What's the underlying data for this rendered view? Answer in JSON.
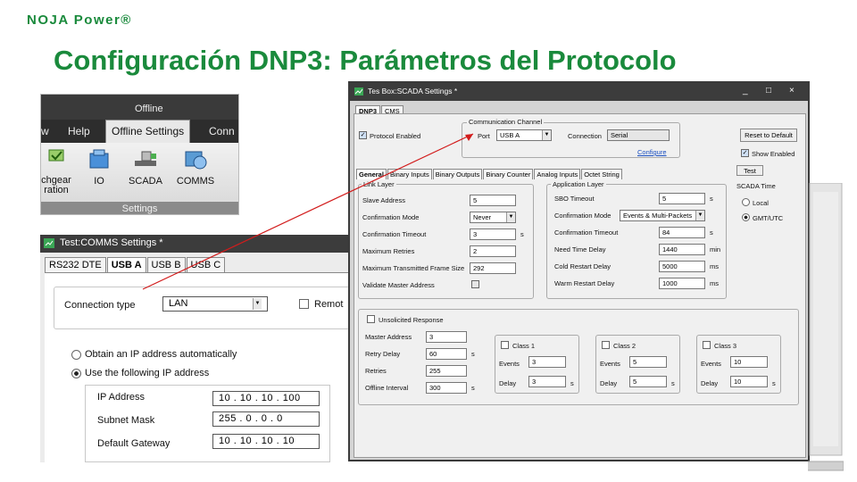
{
  "brand": "NOJA Power®",
  "slide_title": "Configuración DNP3: Parámetros del Protocolo",
  "ribbon": {
    "status": "Offline",
    "tabs": [
      "w",
      "Help",
      "Offline Settings",
      "Conn"
    ],
    "buttons": [
      {
        "label": "chgear\nration",
        "icon": "switchgear-icon"
      },
      {
        "label": "IO",
        "icon": "io-icon"
      },
      {
        "label": "SCADA",
        "icon": "scada-icon"
      },
      {
        "label": "COMMS",
        "icon": "comms-icon"
      }
    ],
    "group_label": "Settings"
  },
  "comms_window": {
    "title": "Test:COMMS Settings *",
    "tabs": [
      "RS232 DTE",
      "USB A",
      "USB B",
      "USB C"
    ],
    "connection_type_label": "Connection type",
    "connection_type_value": "LAN",
    "remote_label": "Remot",
    "obtain_auto_label": "Obtain an IP address automatically",
    "use_following_label": "Use the following IP address",
    "ip_address_label": "IP Address",
    "ip_address_value": "10 . 10 . 10 . 100",
    "subnet_mask_label": "Subnet Mask",
    "subnet_mask_value": "255 . 0 . 0 . 0",
    "gateway_label": "Default Gateway",
    "gateway_value": "10 . 10 . 10 . 10"
  },
  "scada_window": {
    "title": "Tes Box:SCADA Settings *",
    "top_tabs": [
      "DNP3",
      "CMS"
    ],
    "protocol_enabled_label": "Protocol Enabled",
    "comm_channel_label": "Communication Channel",
    "port_label": "Port",
    "port_value": "USB A",
    "connection_label": "Connection",
    "connection_value": "Serial",
    "configure_link": "Configure",
    "reset_button": "Reset to Default",
    "show_enabled_label": "Show Enabled",
    "test_tab": "Test",
    "sub_tabs": [
      "General",
      "Binary Inputs",
      "Binary Outputs",
      "Binary Counter",
      "Analog Inputs",
      "Octet String"
    ],
    "link_layer": {
      "label": "Link Layer",
      "rows": [
        {
          "label": "Slave Address",
          "value": "5",
          "unit": ""
        },
        {
          "label": "Confirmation Mode",
          "value": "Never",
          "unit": ""
        },
        {
          "label": "Confirmation Timeout",
          "value": "3",
          "unit": "s"
        },
        {
          "label": "Maximum Retries",
          "value": "2",
          "unit": ""
        },
        {
          "label": "Maximum Transmitted Frame Size",
          "value": "292",
          "unit": ""
        },
        {
          "label": "Validate Master Address",
          "value": "",
          "unit": ""
        }
      ]
    },
    "app_layer": {
      "label": "Application Layer",
      "rows": [
        {
          "label": "SBO Timeout",
          "value": "5",
          "unit": "s"
        },
        {
          "label": "Confirmation Mode",
          "value": "Events & Multi-Packets",
          "unit": ""
        },
        {
          "label": "Confirmation Timeout",
          "value": "84",
          "unit": "s"
        },
        {
          "label": "Need Time Delay",
          "value": "1440",
          "unit": "min"
        },
        {
          "label": "Cold Restart Delay",
          "value": "5000",
          "unit": "ms"
        },
        {
          "label": "Warm Restart Delay",
          "value": "1000",
          "unit": "ms"
        }
      ]
    },
    "scada_time": {
      "label": "SCADA Time",
      "local": "Local",
      "gmt": "GMT/UTC"
    },
    "unsolicited": {
      "label": "Unsolicited Response",
      "rows": [
        {
          "label": "Master Address",
          "value": "3",
          "unit": ""
        },
        {
          "label": "Retry Delay",
          "value": "60",
          "unit": "s"
        },
        {
          "label": "Retries",
          "value": "255",
          "unit": ""
        },
        {
          "label": "Offline Interval",
          "value": "300",
          "unit": "s"
        }
      ],
      "classes": [
        {
          "label": "Class 1",
          "events": "3",
          "delay": "3"
        },
        {
          "label": "Class 2",
          "events": "5",
          "delay": "5"
        },
        {
          "label": "Class 3",
          "events": "10",
          "delay": "10"
        }
      ],
      "events_label": "Events",
      "delay_label": "Delay",
      "delay_unit": "s"
    }
  },
  "colors": {
    "title_green": "#1a8a3c",
    "arrow_red": "#d21c1c"
  }
}
